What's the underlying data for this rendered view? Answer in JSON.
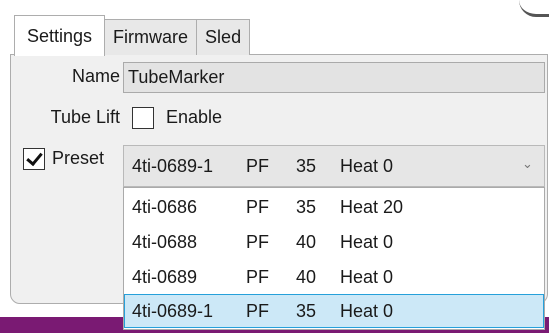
{
  "tabs": [
    {
      "label": "Settings",
      "active": true
    },
    {
      "label": "Firmware",
      "active": false
    },
    {
      "label": "Sled",
      "active": false
    }
  ],
  "name": {
    "label": "Name",
    "value": "TubeMarker"
  },
  "tube_lift": {
    "label": "Tube Lift",
    "checkbox_label": "Enable",
    "checked": false
  },
  "preset": {
    "label": "Preset",
    "checked": true,
    "selected": {
      "id": "4ti-0689-1",
      "type": "PF",
      "num": "35",
      "heat": "Heat 0"
    },
    "options": [
      {
        "id": "4ti-0686",
        "type": "PF",
        "num": "35",
        "heat": "Heat 20"
      },
      {
        "id": "4ti-0688",
        "type": "PF",
        "num": "40",
        "heat": "Heat 0"
      },
      {
        "id": "4ti-0689",
        "type": "PF",
        "num": "40",
        "heat": "Heat 0"
      },
      {
        "id": "4ti-0689-1",
        "type": "PF",
        "num": "35",
        "heat": "Heat 0"
      }
    ],
    "highlighted_index": 3
  },
  "colors": {
    "selection_fill": "#cce8f7",
    "selection_border": "#26a0da",
    "accent_strip": "#7a1a73"
  },
  "icons": {
    "dropdown": "chevron-down-icon",
    "check": "checkmark-icon"
  }
}
